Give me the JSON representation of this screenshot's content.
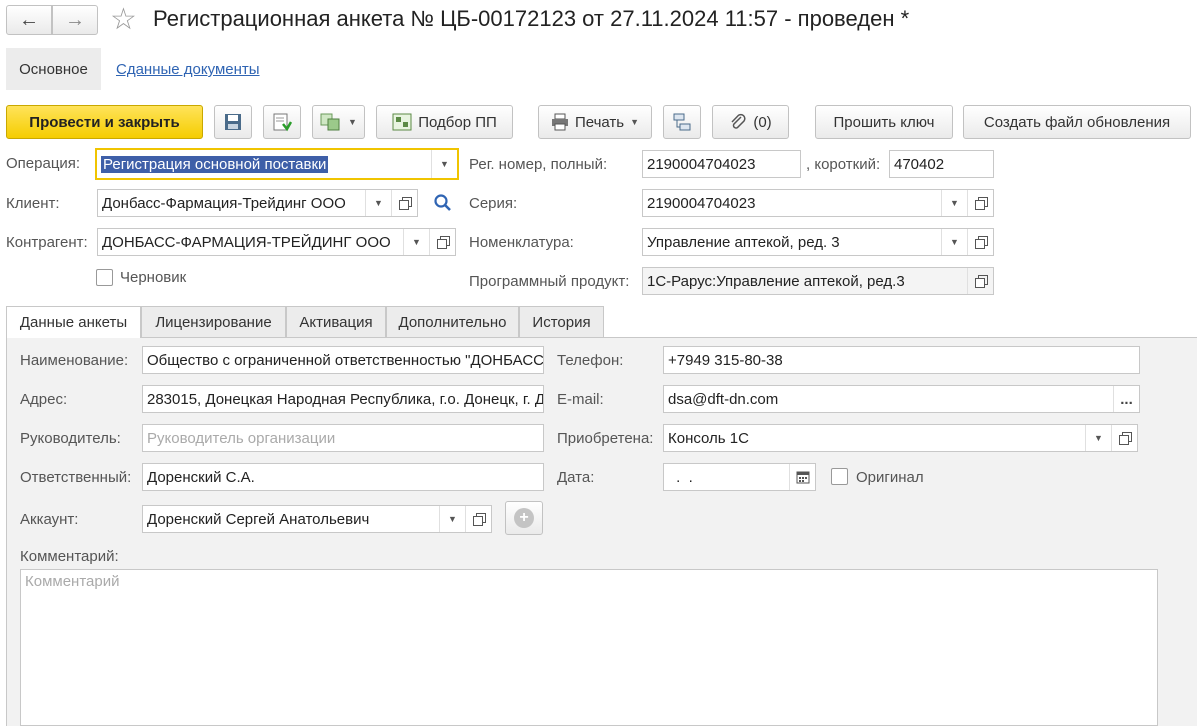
{
  "window": {
    "title": "Регистрационная анкета № ЦБ-00172123 от 27.11.2024 11:57 - проведен *"
  },
  "top_tabs": {
    "main": "Основное",
    "docs": "Сданные документы"
  },
  "toolbar": {
    "post_close": "Провести и закрыть",
    "select_pp": "Подбор ПП",
    "print": "Печать",
    "attach_count": "(0)",
    "flash_key": "Прошить ключ",
    "create_update": "Создать файл обновления"
  },
  "header": {
    "operation_label": "Операция:",
    "operation_value": "Регистрация основной поставки",
    "client_label": "Клиент:",
    "client_value": "Донбасс-Фармация-Трейдинг ООО",
    "counterparty_label": "Контрагент:",
    "counterparty_value": "ДОНБАСС-ФАРМАЦИЯ-ТРЕЙДИНГ ООО",
    "draft_label": "Черновик",
    "reg_full_label": "Рег. номер, полный:",
    "reg_full_value": "2190004704023",
    "reg_short_label": ", короткий:",
    "reg_short_value": "470402",
    "series_label": "Серия:",
    "series_value": "2190004704023",
    "nomenclature_label": "Номенклатура:",
    "nomenclature_value": "Управление аптекой, ред. 3",
    "product_label": "Программный продукт:",
    "product_value": "1С-Рарус:Управление аптекой, ред.3"
  },
  "tabs": {
    "t1": "Данные анкеты",
    "t2": "Лицензирование",
    "t3": "Активация",
    "t4": "Дополнительно",
    "t5": "История"
  },
  "form": {
    "name_label": "Наименование:",
    "name_value": "Общество с ограниченной ответственностью \"ДОНБАСС",
    "address_label": "Адрес:",
    "address_value": "283015, Донецкая Народная Республика, г.о. Донецк, г. Д",
    "director_label": "Руководитель:",
    "director_placeholder": "Руководитель организации",
    "responsible_label": "Ответственный:",
    "responsible_value": "Доренский С.А.",
    "account_label": "Аккаунт:",
    "account_value": "Доренский Сергей Анатольевич",
    "phone_label": "Телефон:",
    "phone_value": "+7949 315-80-38",
    "email_label": "E-mail:",
    "email_value": "dsa@dft-dn.com",
    "email_btn": "...",
    "acquired_label": "Приобретена:",
    "acquired_value": "Консоль 1С",
    "date_label": "Дата:",
    "date_value": " .  .",
    "original_label": "Оригинал",
    "comment_label": "Комментарий:",
    "comment_placeholder": "Комментарий"
  }
}
